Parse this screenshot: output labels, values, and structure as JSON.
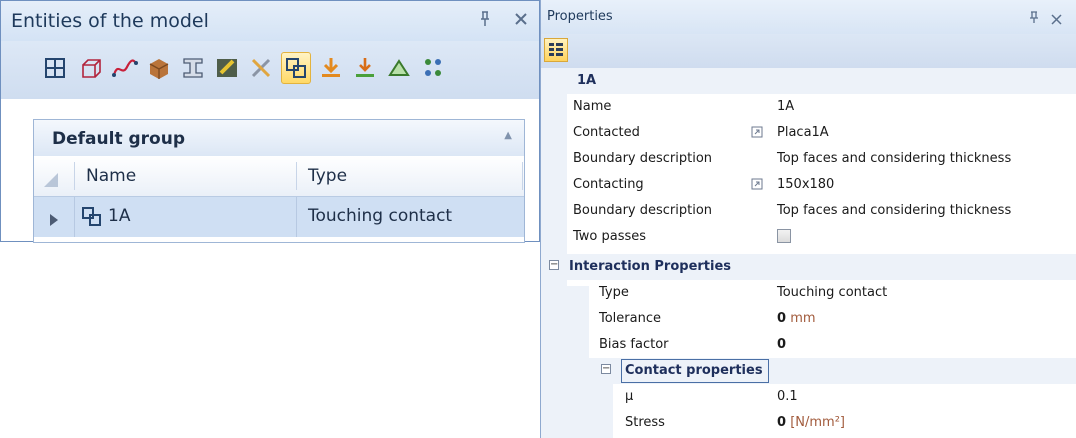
{
  "left": {
    "title": "Entities of the model",
    "group_name": "Default group",
    "columns": [
      "Name",
      "Type"
    ],
    "rows": [
      {
        "name": "1A",
        "type": "Touching contact"
      }
    ],
    "toolbar_icons": [
      "grid-icon",
      "cube-wire-icon",
      "curve-icon",
      "solid-icon",
      "beam-icon",
      "surface-icon",
      "tools-icon",
      "contact-icon",
      "load-icon",
      "support-icon",
      "triangle-icon",
      "group-icon"
    ],
    "selected_tool": "contact-icon"
  },
  "right": {
    "title": "Properties",
    "object": "1A",
    "properties": [
      {
        "name": "Name",
        "value": "1A"
      },
      {
        "name": "Contacted",
        "value": "Placa1A"
      },
      {
        "name": "Boundary description",
        "value": "Top faces and considering thickness"
      },
      {
        "name": "Contacting",
        "value": "150x180"
      },
      {
        "name": "Boundary description",
        "value": "Top faces and considering thickness"
      },
      {
        "name": "Two passes",
        "value": ""
      }
    ],
    "interaction": {
      "label": "Interaction Properties",
      "items": [
        {
          "name": "Type",
          "value": "Touching contact"
        },
        {
          "name": "Tolerance",
          "value": "0",
          "unit": "mm"
        },
        {
          "name": "Bias factor",
          "value": "0"
        }
      ]
    },
    "contact": {
      "label": "Contact properties",
      "items": [
        {
          "name": "µ",
          "value": "0.1"
        },
        {
          "name": "Stress",
          "value": "0",
          "unit": "[N/mm²]"
        }
      ]
    }
  },
  "colors": {
    "accent": "#ffd966",
    "header": "#1e395b",
    "unit": "#a25b3c",
    "selection": "#cfdff3"
  }
}
